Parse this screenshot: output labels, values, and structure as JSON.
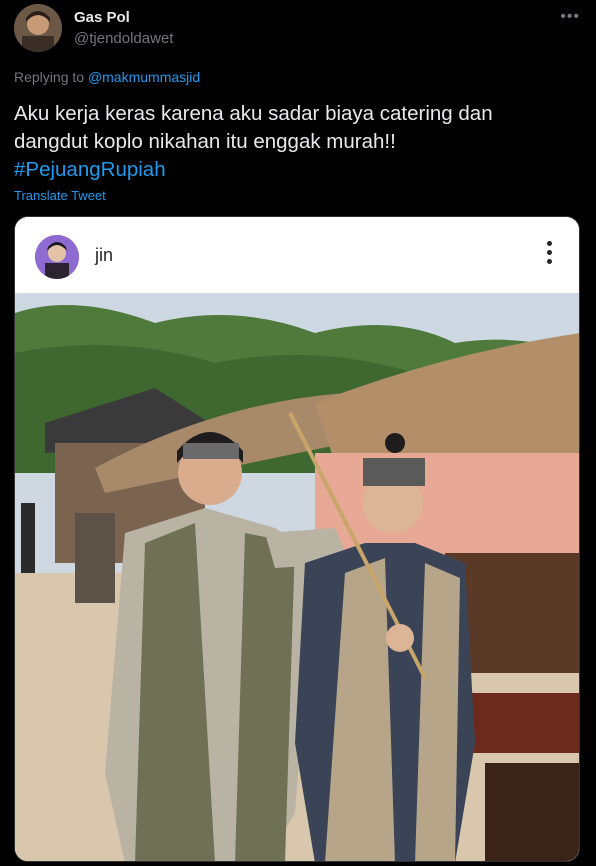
{
  "tweet": {
    "author_name": "Gas Pol",
    "author_handle": "@tjendoldawet",
    "more_icon": "more-horizontal-icon",
    "replying_prefix": "Replying to ",
    "replying_mention": "@makmummasjid",
    "text_line1": "Aku kerja keras karena aku sadar biaya catering dan",
    "text_line2": "dangdut koplo nikahan itu enggak murah!!",
    "hashtag": "#PejuangRupiah",
    "translate_label": "Translate Tweet"
  },
  "embedded_post": {
    "username": "jin",
    "menu_icon": "more-vertical-icon"
  },
  "colors": {
    "background": "#000000",
    "accent": "#1d9bf0",
    "text_primary": "#e7e9ea",
    "text_secondary": "#71767b"
  }
}
